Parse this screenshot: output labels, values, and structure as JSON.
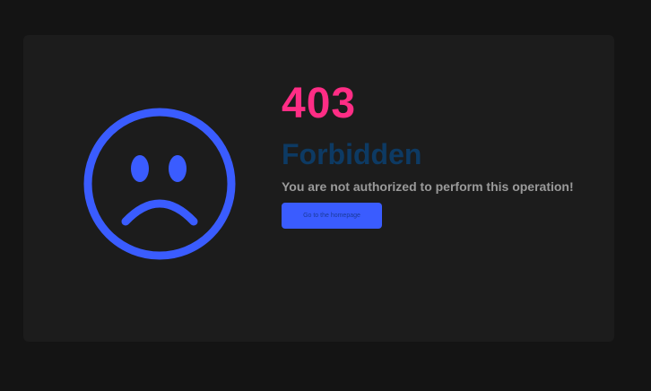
{
  "error": {
    "code": "403",
    "title": "Forbidden",
    "message": "You are not authorized to perform this operation!",
    "home_button_label": "Go to the homepage",
    "icon": "sad-face-icon"
  },
  "colors": {
    "page_background": "#141414",
    "card_background": "#1c1c1c",
    "code": "#ff2d85",
    "title": "#0d3a63",
    "message": "#9a9a9a",
    "accent": "#3a5cff",
    "button_text": "#1a3a9a"
  }
}
